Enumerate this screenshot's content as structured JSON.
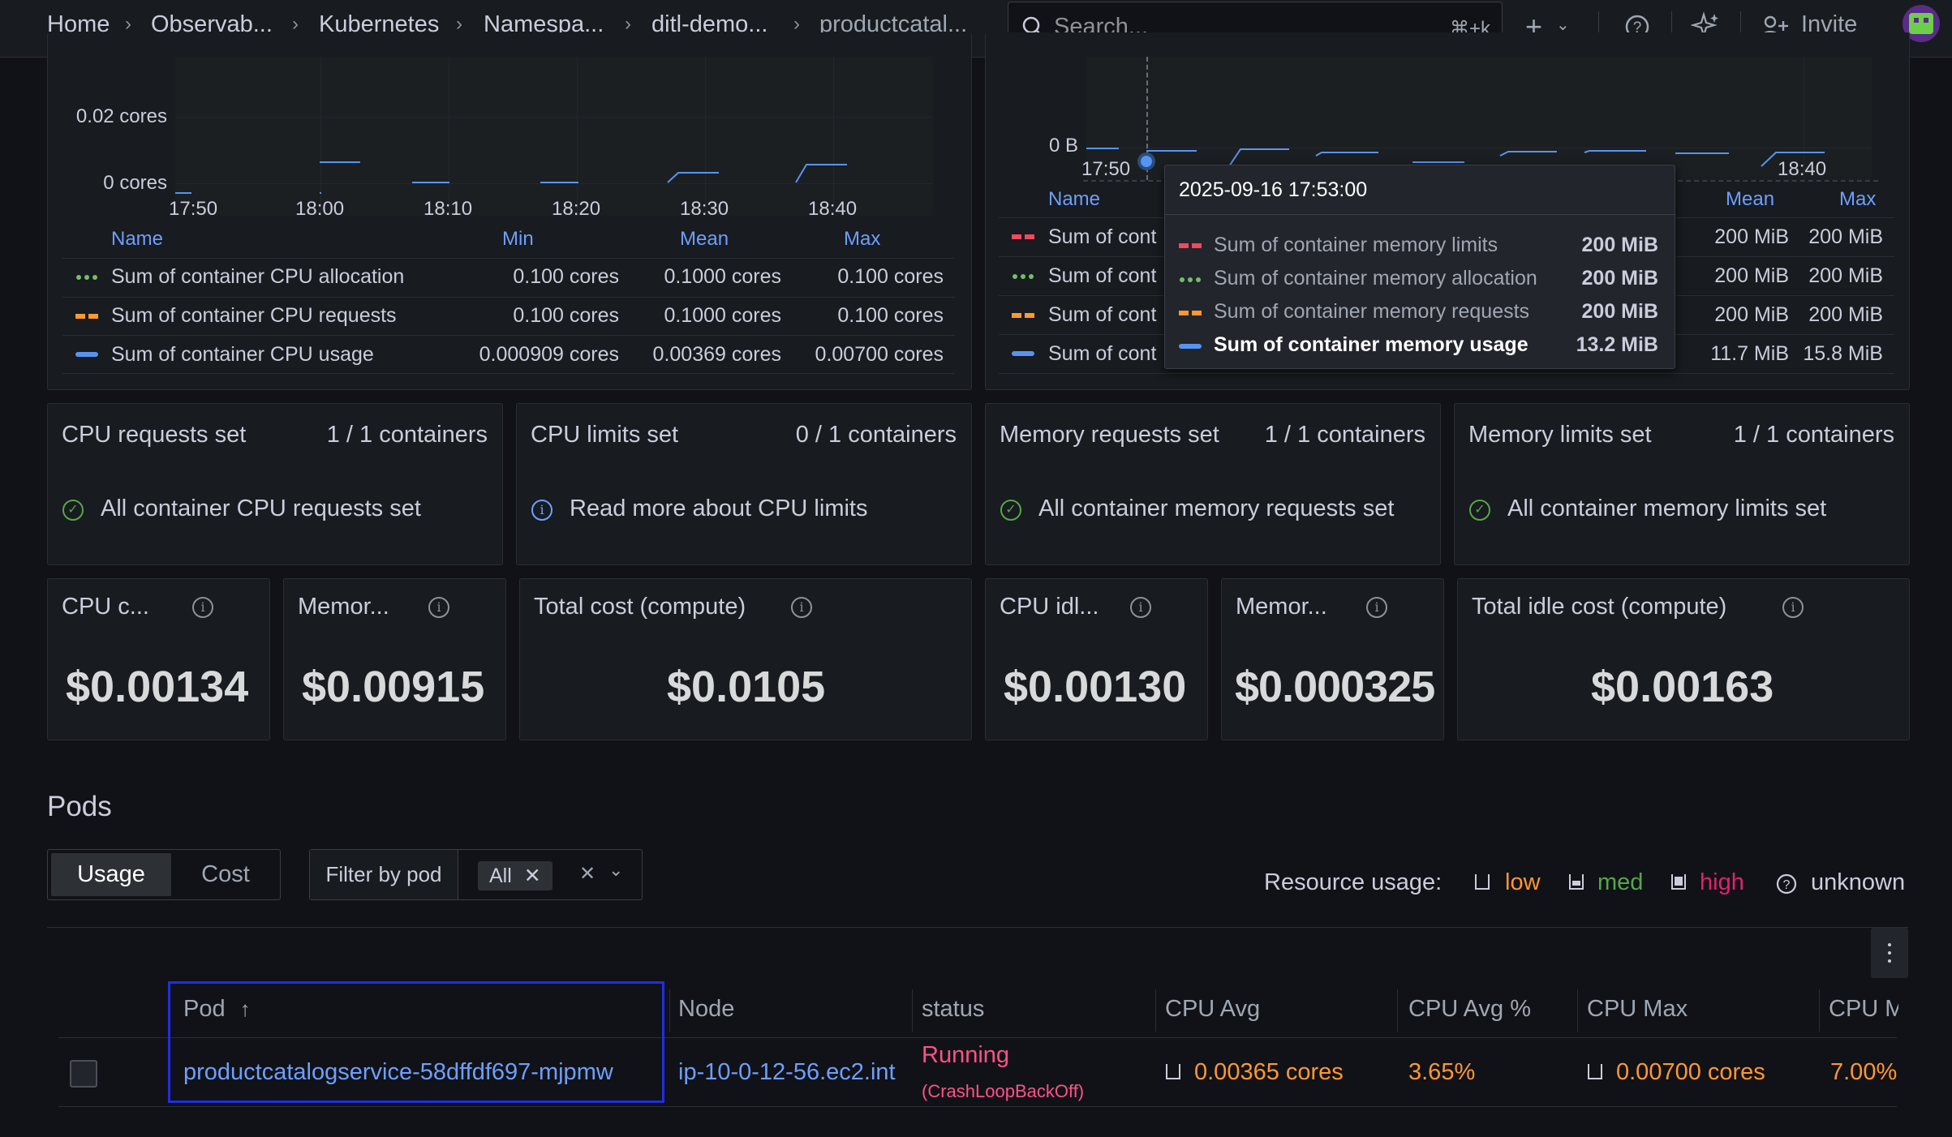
{
  "breadcrumbs": [
    "Home",
    "Observab...",
    "Kubernetes",
    "Namespa...",
    "ditl-demo...",
    "productcatal..."
  ],
  "search": {
    "placeholder": "Search...",
    "shortcut": "⌘+k"
  },
  "topbar": {
    "invite_label": "Invite"
  },
  "cpu_chart": {
    "y_ticks": [
      "0.02 cores",
      "0 cores"
    ],
    "x_ticks": [
      "17:50",
      "18:00",
      "18:10",
      "18:20",
      "18:30",
      "18:40"
    ],
    "legend_headers": {
      "name": "Name",
      "min": "Min",
      "mean": "Mean",
      "max": "Max"
    },
    "legend_rows": [
      {
        "name": "Sum of container CPU allocation",
        "min": "0.100 cores",
        "mean": "0.1000 cores",
        "max": "0.100 cores",
        "color": "#73bf69",
        "style": "dotted"
      },
      {
        "name": "Sum of container CPU requests",
        "min": "0.100 cores",
        "mean": "0.1000 cores",
        "max": "0.100 cores",
        "color": "#ff9830",
        "style": "dashed"
      },
      {
        "name": "Sum of container CPU usage",
        "min": "0.000909 cores",
        "mean": "0.00369 cores",
        "max": "0.00700 cores",
        "color": "#5794f2",
        "style": "solid"
      }
    ]
  },
  "memory_chart": {
    "y_ticks": [
      "0 B"
    ],
    "x_ticks": [
      "17:50",
      "18:40"
    ],
    "legend_headers": {
      "name": "Name",
      "mean": "Mean",
      "max": "Max"
    },
    "legend_rows": [
      {
        "name": "Sum of cont",
        "mean": "200 MiB",
        "max": "200 MiB",
        "color": "#f2495c",
        "style": "dashed"
      },
      {
        "name": "Sum of cont",
        "mean": "200 MiB",
        "max": "200 MiB",
        "color": "#73bf69",
        "style": "dotted"
      },
      {
        "name": "Sum of cont",
        "mean": "200 MiB",
        "max": "200 MiB",
        "color": "#ff9830",
        "style": "dashed"
      },
      {
        "name": "Sum of cont",
        "mean": "11.7 MiB",
        "max": "15.8 MiB",
        "color": "#5794f2",
        "style": "solid"
      }
    ],
    "tooltip": {
      "time": "2025-09-16 17:53:00",
      "rows": [
        {
          "name": "Sum of container memory limits",
          "value": "200 MiB",
          "color": "#f2495c",
          "style": "dashed",
          "highlight": false
        },
        {
          "name": "Sum of container memory allocation",
          "value": "200 MiB",
          "color": "#73bf69",
          "style": "dotted",
          "highlight": false
        },
        {
          "name": "Sum of container memory requests",
          "value": "200 MiB",
          "color": "#ff9830",
          "style": "dashed",
          "highlight": false
        },
        {
          "name": "Sum of container memory usage",
          "value": "13.2 MiB",
          "color": "#5794f2",
          "style": "solid",
          "highlight": true
        }
      ]
    }
  },
  "requests_panels": [
    {
      "title": "CPU requests set",
      "count": "1 / 1 containers",
      "message": "All container CPU requests set",
      "icon": "check-circle-icon"
    },
    {
      "title": "CPU limits set",
      "count": "0 / 1 containers",
      "message": "Read more about CPU limits",
      "icon": "info-circle-icon"
    },
    {
      "title": "Memory requests set",
      "count": "1 / 1 containers",
      "message": "All container memory requests set",
      "icon": "check-circle-icon"
    },
    {
      "title": "Memory limits set",
      "count": "1 / 1 containers",
      "message": "All container memory limits set",
      "icon": "check-circle-icon"
    }
  ],
  "cost_panels": [
    {
      "title": "CPU c...",
      "value": "$0.00134"
    },
    {
      "title": "Memor...",
      "value": "$0.00915"
    },
    {
      "title": "Total cost (compute)",
      "value": "$0.0105"
    },
    {
      "title": "CPU idl...",
      "value": "$0.00130"
    },
    {
      "title": "Memor...",
      "value": "$0.000325"
    },
    {
      "title": "Total idle cost (compute)",
      "value": "$0.00163"
    }
  ],
  "pods": {
    "heading": "Pods",
    "tabs": [
      "Usage",
      "Cost"
    ],
    "active_tab": "Usage",
    "filter_label": "Filter by pod",
    "filter_chip": "All",
    "resource_usage": {
      "label": "Resource usage:",
      "low": "low",
      "med": "med",
      "high": "high",
      "unknown": "unknown"
    },
    "columns": [
      "Pod",
      "Node",
      "status",
      "CPU Avg",
      "CPU Avg %",
      "CPU Max",
      "CPU M"
    ],
    "sort_indicator": "↑",
    "rows": [
      {
        "pod": "productcatalogservice-58dffdf697-mjpmw",
        "node": "ip-10-0-12-56.ec2.int",
        "status": "Running",
        "status_detail": "(CrashLoopBackOff)",
        "cpu_avg": "0.00365 cores",
        "cpu_avg_pct": "3.65%",
        "cpu_max": "0.00700 cores",
        "cpu_max_pct": "7.00%"
      }
    ]
  },
  "colors": {
    "accent": "#6e9fff",
    "low": "#ff9830",
    "med": "#56a64b",
    "high": "#e0226e",
    "error": "#ff5286",
    "highlight_box": "#1f2ee6"
  }
}
